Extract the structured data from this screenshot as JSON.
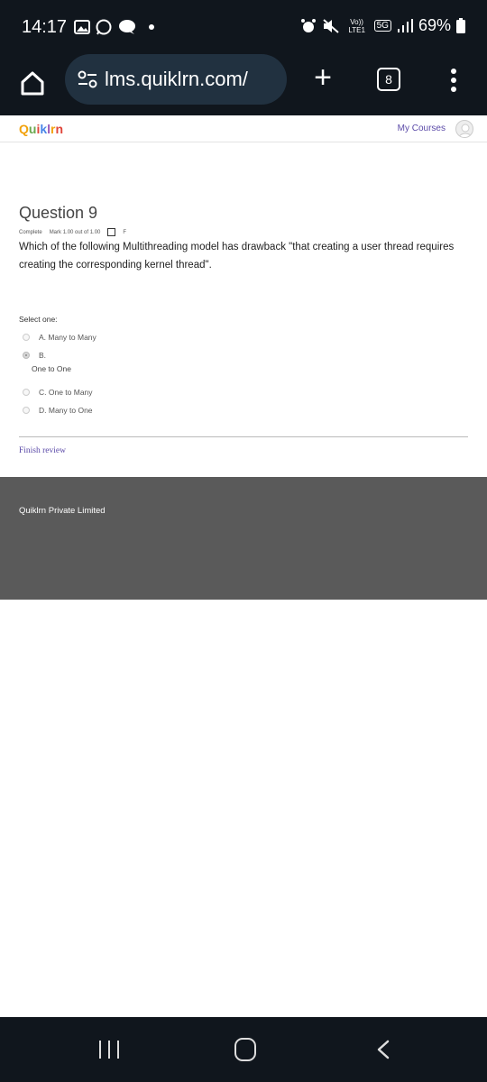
{
  "status_bar": {
    "time": "14:17",
    "network": "5G",
    "volte": "Vo)) LTE1",
    "battery": "69%",
    "icons": [
      "gallery-icon",
      "whatsapp-icon",
      "chat-bubble-icon",
      "dot-icon",
      "alarm-icon",
      "mute-icon",
      "signal-icon",
      "battery-icon"
    ]
  },
  "browser": {
    "url": "lms.quiklrn.com/",
    "tab_count": "8",
    "icons": [
      "home-icon",
      "site-settings-icon",
      "plus-icon",
      "tabs-icon",
      "more-vert-icon"
    ]
  },
  "site": {
    "logo": "Quiklrn",
    "logo_colors": [
      "#f2a20c",
      "#6aa84f",
      "#e0463a",
      "#4a86e8",
      "#9b59b6"
    ],
    "my_courses": "My Courses",
    "accent_color": "#5b4aa8"
  },
  "question": {
    "title": "Question 9",
    "state": "Complete",
    "mark": "Mark 1.00 out of 1.00",
    "flag": "F",
    "text": "Which of the following Multithreading model has drawback \"that creating a user thread requires creating the corresponding kernel thread\".",
    "select_label": "Select one:",
    "options": [
      {
        "label": "A. Many to Many",
        "selected": false
      },
      {
        "label": "B.",
        "sub": "One to One",
        "selected": true
      },
      {
        "label": "C. One to Many",
        "selected": false
      },
      {
        "label": "D. Many to One",
        "selected": false
      }
    ],
    "finish_review": "Finish review"
  },
  "footer": {
    "text": "Quiklrn Private Limited"
  }
}
